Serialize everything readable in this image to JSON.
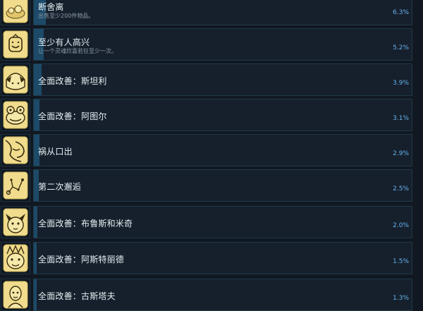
{
  "achievements": [
    {
      "title": "断舍离",
      "desc": "出售至少200件物品。",
      "percent": "6.3%",
      "fill": 0.063,
      "icon": "treasure-pile-icon"
    },
    {
      "title": "至少有人高兴",
      "desc": "让一个灵魂欣喜若狂至少一次。",
      "percent": "5.2%",
      "fill": 0.052,
      "icon": "happy-lantern-icon"
    },
    {
      "title": "全面改善：斯坦利",
      "desc": "",
      "percent": "3.9%",
      "fill": 0.039,
      "icon": "stanley-portrait-icon"
    },
    {
      "title": "全面改善：阿图尔",
      "desc": "",
      "percent": "3.1%",
      "fill": 0.031,
      "icon": "atul-frog-portrait-icon"
    },
    {
      "title": "祸从口出",
      "desc": "",
      "percent": "2.9%",
      "fill": 0.029,
      "icon": "open-mouth-icon"
    },
    {
      "title": "第二次邂逅",
      "desc": "",
      "percent": "2.5%",
      "fill": 0.025,
      "icon": "constellation-icon"
    },
    {
      "title": "全面改善：布鲁斯和米奇",
      "desc": "",
      "percent": "2.0%",
      "fill": 0.02,
      "icon": "bruce-and-mickey-portrait-icon"
    },
    {
      "title": "全面改善：阿斯特丽德",
      "desc": "",
      "percent": "1.5%",
      "fill": 0.015,
      "icon": "astrid-portrait-icon"
    },
    {
      "title": "全面改善：古斯塔夫",
      "desc": "",
      "percent": "1.3%",
      "fill": 0.013,
      "icon": "gustav-portrait-icon"
    }
  ],
  "colors": {
    "background": "#111822",
    "card": "#16202c",
    "card_border": "#1f3a47",
    "progress_fill": "#1c4a68",
    "title": "#e6edf3",
    "description": "#8b98a5",
    "percent": "#66b3f0",
    "icon_gold": "#f0dc8c"
  }
}
